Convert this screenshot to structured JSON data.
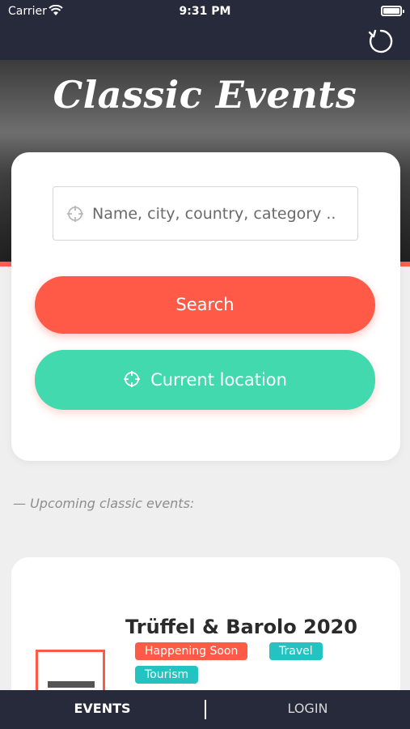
{
  "status_bar": {
    "carrier": "Carrier",
    "time": "9:31 PM"
  },
  "hero": {
    "title": "Classic Events"
  },
  "search": {
    "placeholder": "Name, city, country, category ..",
    "search_button": "Search",
    "location_button": "Current location"
  },
  "upcoming": {
    "label": "— Upcoming classic events:"
  },
  "event": {
    "title": "Trüffel & Barolo 2020",
    "tags": [
      "Happening Soon",
      "Travel",
      "Tourism"
    ]
  },
  "tab_bar": {
    "events": "EVENTS",
    "login": "LOGIN"
  },
  "colors": {
    "accent": "#ff5a48",
    "secondary": "#43d9ae",
    "tag_teal": "#24c3c1",
    "nav": "#262a3a"
  },
  "icons": {
    "refresh": "refresh-icon",
    "location": "crosshair-icon",
    "wifi": "wifi-icon",
    "battery": "battery-icon"
  }
}
